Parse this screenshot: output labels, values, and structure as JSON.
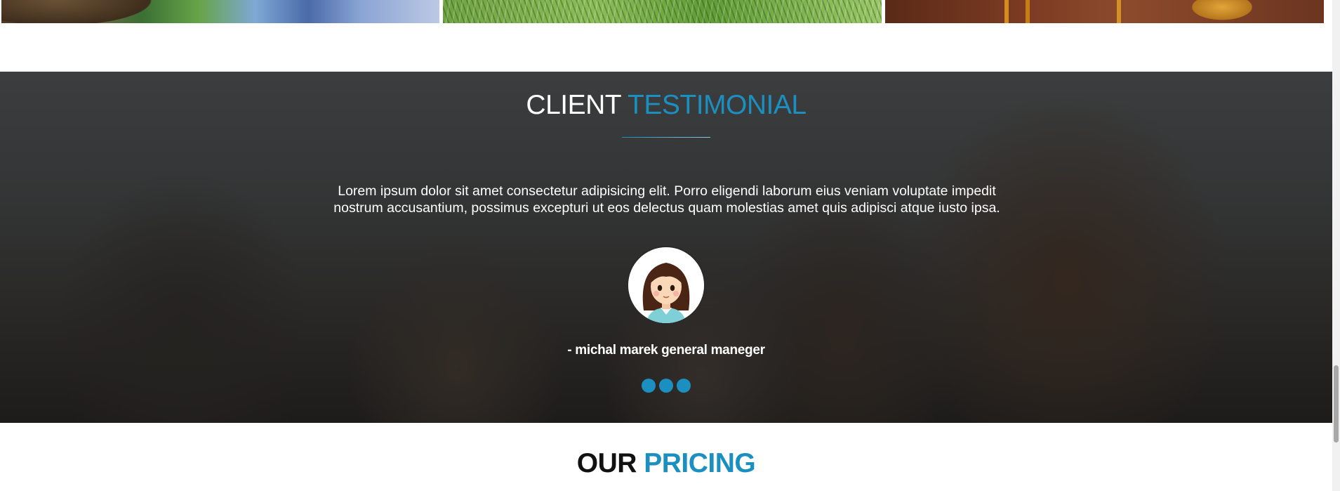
{
  "gallery": {
    "tiles": [
      "bird-photo",
      "grass-photo",
      "honey-photo"
    ]
  },
  "testimonial": {
    "title_part1": "CLIENT",
    "title_part2": "TESTIMONIAL",
    "quote": "Lorem ipsum dolor sit amet consectetur adipisicing elit. Porro eligendi laborum eius veniam voluptate impedit nostrum accusantium, possimus excepturi ut eos delectus quam molestias amet quis adipisci atque iusto ipsa.",
    "author": "- michal marek general maneger",
    "slides_count": 3
  },
  "pricing": {
    "title_part1": "OUR",
    "title_part2": "PRICING"
  },
  "colors": {
    "accent": "#1b8fc0",
    "overlay": "#141414"
  }
}
